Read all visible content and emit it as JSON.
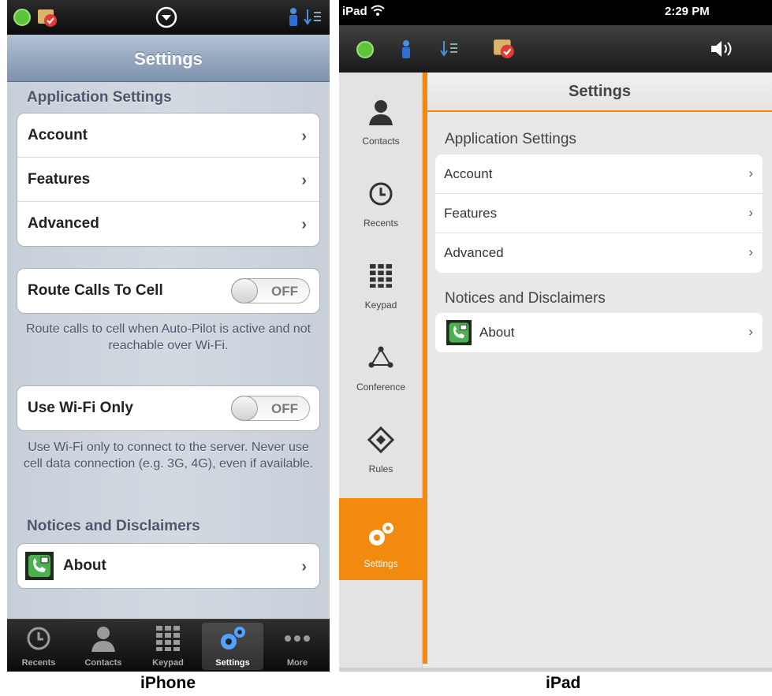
{
  "iphone": {
    "nav_title": "Settings",
    "sections": {
      "application_header": "Application Settings",
      "notices_header": "Notices and Disclaimers"
    },
    "app_rows": [
      {
        "label": "Account"
      },
      {
        "label": "Features"
      },
      {
        "label": "Advanced"
      }
    ],
    "route_calls": {
      "label": "Route Calls To Cell",
      "toggle": "OFF",
      "note": "Route calls to cell when Auto-Pilot is active and not reachable over Wi-Fi."
    },
    "wifi_only": {
      "label": "Use Wi-Fi Only",
      "toggle": "OFF",
      "note": "Use Wi-Fi only to connect to the server. Never use cell data connection (e.g. 3G, 4G), even if available."
    },
    "about": {
      "label": "About"
    },
    "tabs": [
      {
        "label": "Recents",
        "icon": "clock-icon"
      },
      {
        "label": "Contacts",
        "icon": "person-icon"
      },
      {
        "label": "Keypad",
        "icon": "keypad-icon"
      },
      {
        "label": "Settings",
        "icon": "gears-icon",
        "active": true
      },
      {
        "label": "More",
        "icon": "more-icon"
      }
    ],
    "caption": "iPhone"
  },
  "ipad": {
    "status": {
      "device": "iPad",
      "time": "2:29 PM"
    },
    "title": "Settings",
    "sidebar": [
      {
        "label": "Contacts",
        "icon": "person-icon"
      },
      {
        "label": "Recents",
        "icon": "clock-icon"
      },
      {
        "label": "Keypad",
        "icon": "keypad-icon"
      },
      {
        "label": "Conference",
        "icon": "conference-icon"
      },
      {
        "label": "Rules",
        "icon": "rules-icon"
      },
      {
        "label": "Settings",
        "icon": "gears-icon",
        "active": true
      }
    ],
    "sections": {
      "application_header": "Application Settings",
      "notices_header": "Notices and Disclaimers"
    },
    "app_rows": [
      {
        "label": "Account"
      },
      {
        "label": "Features"
      },
      {
        "label": "Advanced"
      }
    ],
    "about": {
      "label": "About"
    },
    "caption": "iPad"
  },
  "colors": {
    "accent_orange": "#f28a10",
    "iphone_nav": "#8ea1bb",
    "status_green": "#5cc53a"
  }
}
